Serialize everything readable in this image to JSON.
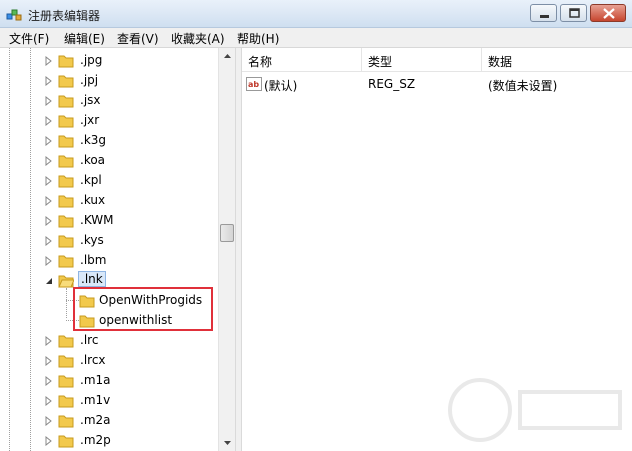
{
  "window": {
    "title": "注册表编辑器",
    "controls": {
      "minimize": "minimize",
      "maximize": "maximize",
      "close": "close"
    }
  },
  "menu": {
    "items": [
      "文件(F)",
      "编辑(E)",
      "查看(V)",
      "收藏夹(A)",
      "帮助(H)"
    ]
  },
  "tree": {
    "items": [
      ".jpg",
      ".jpj",
      ".jsx",
      ".jxr",
      ".k3g",
      ".koa",
      ".kpl",
      ".kux",
      ".KWM",
      ".kys",
      ".lbm",
      ".lnk",
      ".lrc",
      ".lrcx",
      ".m1a",
      ".m1v",
      ".m2a",
      ".m2p"
    ],
    "selected": ".lnk",
    "children_of_selected": [
      "OpenWithProgids",
      "openwithlist"
    ]
  },
  "list": {
    "columns": [
      "名称",
      "类型",
      "数据"
    ],
    "rows": [
      {
        "name": "(默认)",
        "type": "REG_SZ",
        "data": "(数值未设置)"
      }
    ]
  },
  "colors": {
    "highlight_box": "#e0303a",
    "folder": "#f2c94c",
    "selection": "#d9e8f9"
  }
}
